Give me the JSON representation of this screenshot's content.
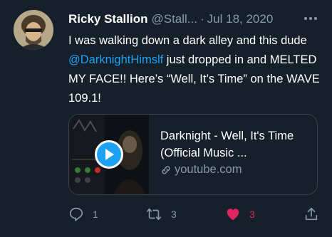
{
  "tweet": {
    "author_name": "Ricky Stallion",
    "handle": "@Stall...",
    "separator": "·",
    "date": "Jul 18, 2020",
    "more_label": "•••",
    "text_before": "I was walking down a dark alley and this dude ",
    "mention": "@DarknightHimslf",
    "text_after": " just dropped in and MELTED MY FACE!!  Here’s “Well, It’s Time” on the WAVE 109.1!"
  },
  "card": {
    "title": "Darknight - Well, It's Time (Official Music ...",
    "domain": "youtube.com",
    "thumbnail_icon": "video-thumbnail",
    "play_icon": "play-icon",
    "link_icon": "link-icon"
  },
  "actions": {
    "reply_count": "1",
    "retweet_count": "3",
    "like_count": "3",
    "like_color": "#e0245e",
    "accent_color": "#1da1f2"
  }
}
